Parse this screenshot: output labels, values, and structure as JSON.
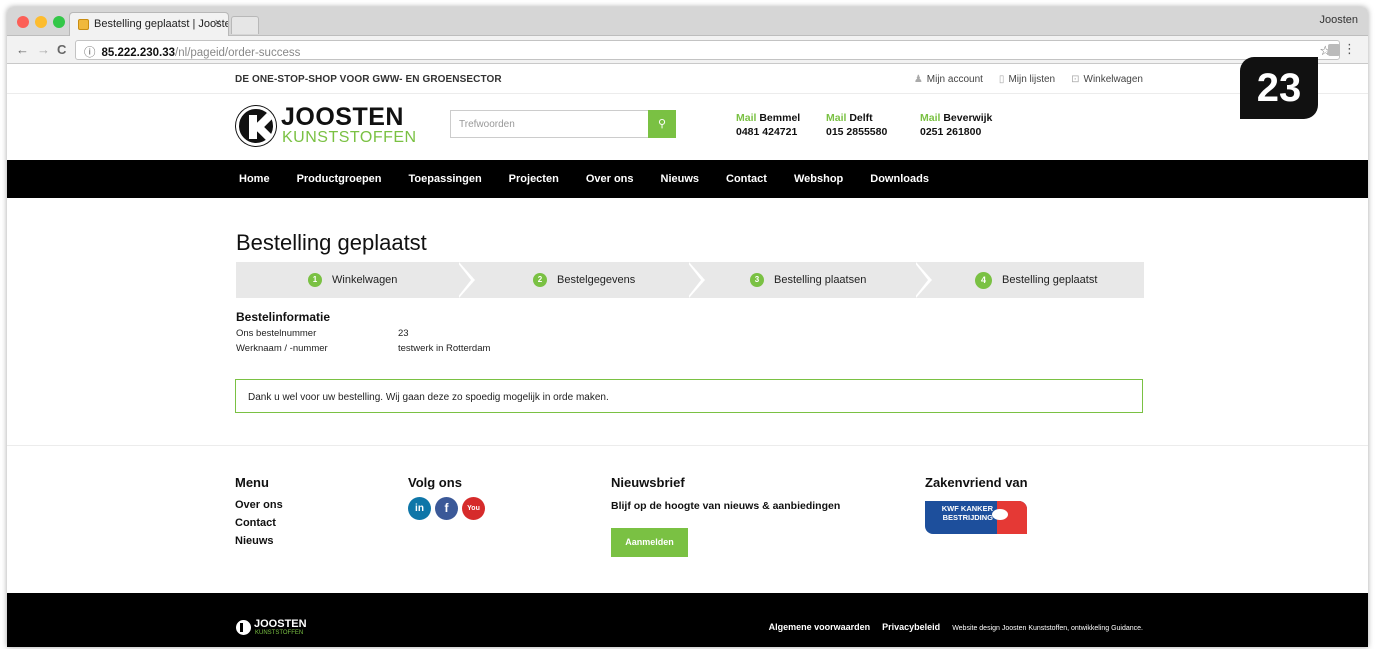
{
  "browser": {
    "tab_title": "Bestelling geplaatst | Joosten",
    "tab_close": "×",
    "profile_name": "Joosten",
    "url_host": "85.222.230.33",
    "url_path": "/nl/pageid/order-success",
    "back_glyph": "←",
    "forward_glyph": "→",
    "reload_glyph": "C",
    "info_glyph": "ⓘ",
    "star_glyph": "☆",
    "menu_glyph": "⋮"
  },
  "site": {
    "tagline": "DE ONE-STOP-SHOP VOOR GWW- EN GROENSECTOR",
    "account_links": [
      "Mijn account",
      "Mijn lijsten",
      "Winkelwagen"
    ],
    "logo_line1": "JOOSTEN",
    "logo_line2": "KUNSTSTOFFEN",
    "search_placeholder": "Trefwoorden",
    "search_glyph": "⚲",
    "contacts": [
      {
        "mail": "Mail",
        "city": "Bemmel",
        "phone": "0481 424721"
      },
      {
        "mail": "Mail",
        "city": "Delft",
        "phone": "015 2855580"
      },
      {
        "mail": "Mail",
        "city": "Beverwijk",
        "phone": "0251 261800"
      }
    ],
    "nav": [
      "Home",
      "Productgroepen",
      "Toepassingen",
      "Projecten",
      "Over ons",
      "Nieuws",
      "Contact",
      "Webshop",
      "Downloads"
    ]
  },
  "page": {
    "title": "Bestelling geplaatst",
    "steps": [
      {
        "num": "1",
        "label": "Winkelwagen"
      },
      {
        "num": "2",
        "label": "Bestelgegevens"
      },
      {
        "num": "3",
        "label": "Bestelling plaatsen"
      },
      {
        "num": "4",
        "label": "Bestelling geplaatst"
      }
    ],
    "current_step": 4,
    "info_title": "Bestelinformatie",
    "info": [
      {
        "label": "Ons bestelnummer",
        "value": "23"
      },
      {
        "label": "Werknaam / -nummer",
        "value": "testwerk in Rotterdam"
      }
    ],
    "notice": "Dank u wel voor uw bestelling. Wij gaan deze zo spoedig mogelijk in orde maken."
  },
  "footer": {
    "menu_title": "Menu",
    "menu_items": [
      "Over ons",
      "Contact",
      "Nieuws"
    ],
    "social_title": "Volg ons",
    "social": [
      {
        "name": "linkedin",
        "glyph": "in",
        "color": "#0e76a8"
      },
      {
        "name": "facebook",
        "glyph": "f",
        "color": "#3b5998"
      },
      {
        "name": "youtube",
        "glyph": "You",
        "color": "#d62b2b"
      }
    ],
    "news_title": "Nieuwsbrief",
    "news_text": "Blijf op de hoogte van nieuws & aanbiedingen",
    "news_button": "Aanmelden",
    "partner_title": "Zakenvriend van",
    "partner_text": "KWF KANKER BESTRIJDING",
    "bottom_logo_line1": "JOOSTEN",
    "bottom_logo_line2": "KUNSTSTOFFEN",
    "bottom_links": [
      "Algemene voorwaarden",
      "Privacybeleid"
    ],
    "credit": "Website design Joosten Kunststoffen, ontwikkeling Guidance."
  },
  "badge": "23",
  "colors": {
    "accent": "#7ac143",
    "nav_bg": "#000000",
    "step_bg": "#e8e8e8"
  }
}
